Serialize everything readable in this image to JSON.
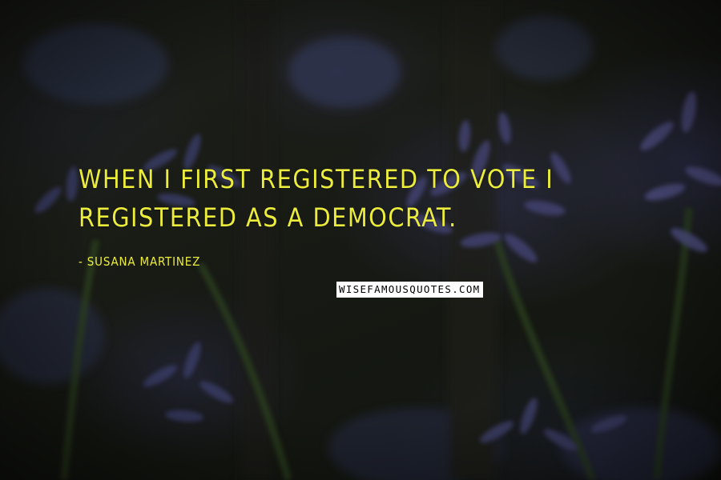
{
  "quote": {
    "text": "When I first registered to vote I registered as a Democrat.",
    "author_prefix": "- ",
    "author": "Susana Martinez"
  },
  "watermark": {
    "text": "WISEFAMOUSQUOTES.COM"
  },
  "colors": {
    "quote_text": "#ecec3c",
    "watermark_bg": "#ffffff",
    "watermark_text": "#000000"
  }
}
